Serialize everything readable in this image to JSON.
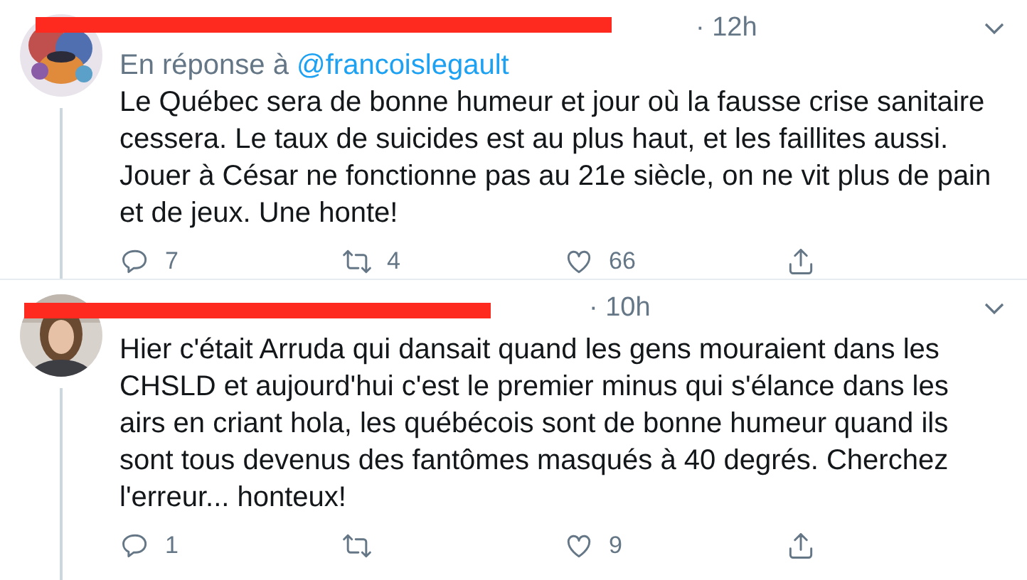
{
  "tweets": [
    {
      "author_redacted": true,
      "time": "· 12h",
      "reply_prefix": "En réponse à",
      "reply_to": "@francoislegault",
      "text": "Le Québec sera de bonne humeur et jour où la fausse crise sanitaire cessera. Le taux de suicides est au plus haut, et les faillites aussi. Jouer à César ne fonctionne pas au 21e siècle, on ne vit plus de pain et de jeux. Une honte!",
      "replies": "7",
      "retweets": "4",
      "likes": "66",
      "thread_line": true
    },
    {
      "author_redacted": true,
      "time": "· 10h",
      "text": "Hier c'était Arruda qui dansait quand les gens mouraient dans les CHSLD et aujourd'hui c'est le premier minus qui s'élance dans les airs en criant hola, les québécois sont de bonne humeur quand ils sont tous devenus des fantômes masqués à 40 degrés. Cherchez l'erreur... honteux!",
      "replies": "1",
      "likes": "9",
      "thread_line": true
    }
  ]
}
